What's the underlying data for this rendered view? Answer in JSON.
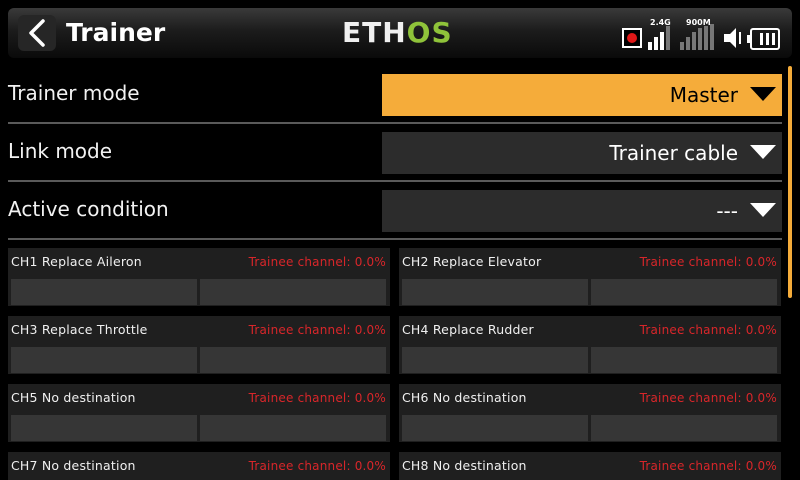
{
  "header": {
    "title": "Trainer",
    "logo_left": "ETH",
    "logo_right": "OS",
    "signal_24_label": "2.4G",
    "signal_900_label": "900M",
    "colors": {
      "accent": "#f5ac3a",
      "logo_green": "#8fc33a",
      "record_red": "#e01818"
    },
    "icons": [
      "back-chevron-icon",
      "record-icon",
      "signal-bars-icon",
      "speaker-muted-icon",
      "battery-icon"
    ]
  },
  "settings": [
    {
      "label": "Trainer mode",
      "value": "Master",
      "active": true
    },
    {
      "label": "Link mode",
      "value": "Trainer cable",
      "active": false
    },
    {
      "label": "Active condition",
      "value": "---",
      "active": false
    }
  ],
  "channels": [
    {
      "name": "CH1 Replace Aileron",
      "trainee": "Trainee channel: 0.0%"
    },
    {
      "name": "CH2 Replace Elevator",
      "trainee": "Trainee channel: 0.0%"
    },
    {
      "name": "CH3 Replace Throttle",
      "trainee": "Trainee channel: 0.0%"
    },
    {
      "name": "CH4 Replace Rudder",
      "trainee": "Trainee channel: 0.0%"
    },
    {
      "name": "CH5 No destination",
      "trainee": "Trainee channel: 0.0%"
    },
    {
      "name": "CH6 No destination",
      "trainee": "Trainee channel: 0.0%"
    },
    {
      "name": "CH7 No destination",
      "trainee": "Trainee channel: 0.0%"
    },
    {
      "name": "CH8 No destination",
      "trainee": "Trainee channel: 0.0%"
    }
  ]
}
